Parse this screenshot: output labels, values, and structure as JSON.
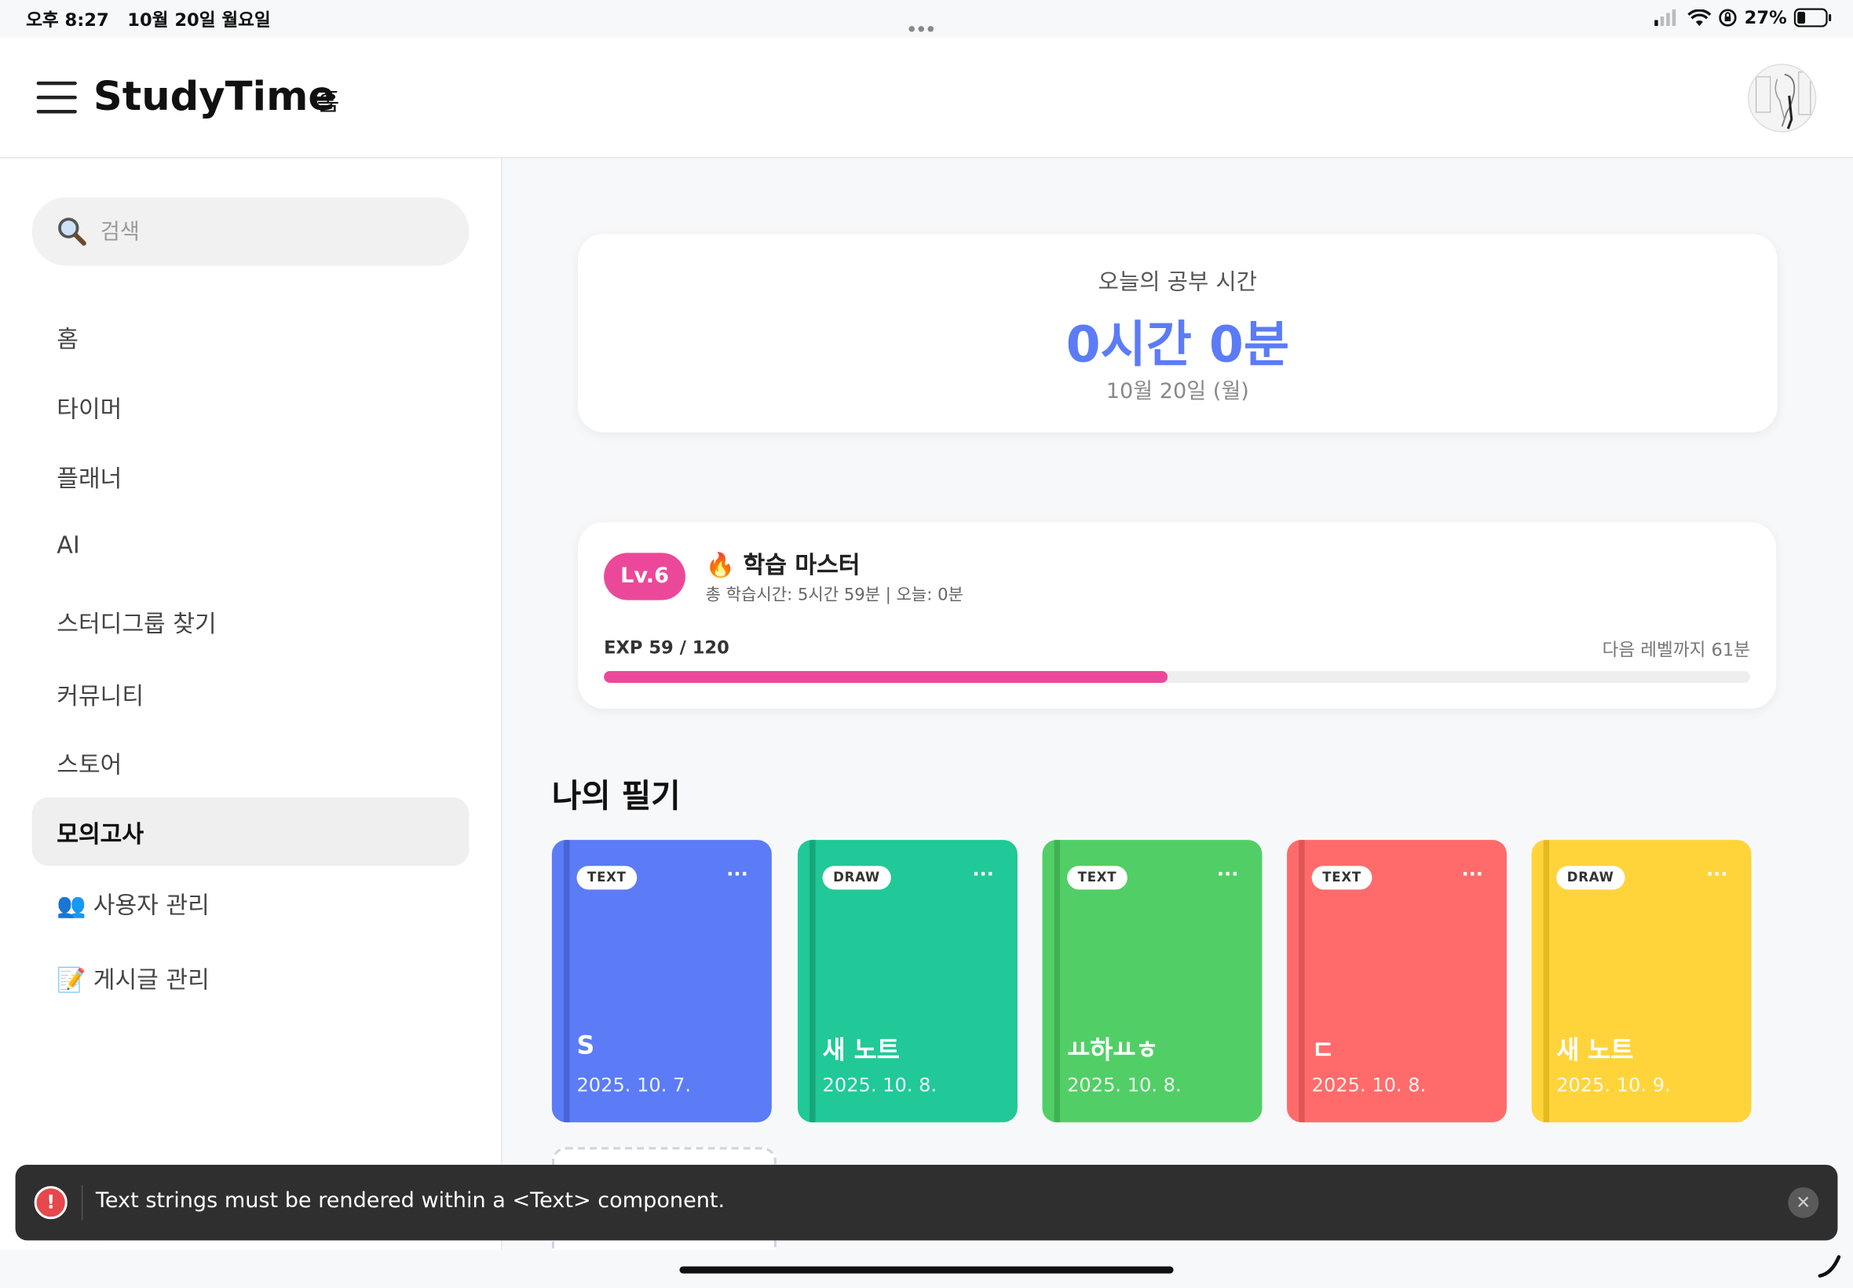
{
  "status_bar": {
    "time": "오후 8:27",
    "date": "10월 20일 월요일",
    "battery": "27%"
  },
  "header": {
    "title": "StudyTime",
    "breadcrumb": "홈"
  },
  "sidebar": {
    "search_placeholder": "검색",
    "items": [
      {
        "label": "홈",
        "emoji": ""
      },
      {
        "label": "타이머",
        "emoji": ""
      },
      {
        "label": "플래너",
        "emoji": ""
      },
      {
        "label": "AI",
        "emoji": ""
      },
      {
        "label": "스터디그룹 찾기",
        "emoji": ""
      },
      {
        "label": "커뮤니티",
        "emoji": ""
      },
      {
        "label": "스토어",
        "emoji": ""
      },
      {
        "label": "모의고사",
        "emoji": "",
        "active": true
      },
      {
        "label": "사용자 관리",
        "emoji": "👥"
      },
      {
        "label": "게시글 관리",
        "emoji": "📝"
      }
    ]
  },
  "today": {
    "label": "오늘의 공부 시간",
    "time": "0시간 0분",
    "date": "10월 20일 (월)"
  },
  "level": {
    "badge": "Lv.6",
    "title": "🔥 학습 마스터",
    "subtitle": "총 학습시간: 5시간 59분 | 오늘: 0분",
    "exp_text": "EXP 59 / 120",
    "next_text": "다음 레벨까지 61분",
    "progress": 0.4917
  },
  "notes": {
    "section_title": "나의 필기",
    "items": [
      {
        "type": "TEXT",
        "title": "S",
        "date": "2025. 10. 7.",
        "color": "#5b7cf6",
        "spine": "#4a63d6"
      },
      {
        "type": "DRAW",
        "title": "새 노트",
        "date": "2025. 10. 8.",
        "color": "#20c997",
        "spine": "#17a67c"
      },
      {
        "type": "TEXT",
        "title": "ㅛ하ㅛㅎ",
        "date": "2025. 10. 8.",
        "color": "#51cf66",
        "spine": "#3fb153"
      },
      {
        "type": "TEXT",
        "title": "ㄷ",
        "date": "2025. 10. 8.",
        "color": "#ff6b6b",
        "spine": "#e05656"
      },
      {
        "type": "DRAW",
        "title": "새 노트",
        "date": "2025. 10. 9.",
        "color": "#ffd43b",
        "spine": "#e6b923"
      }
    ]
  },
  "toast": {
    "message": "Text strings must be rendered within a <Text> component."
  }
}
